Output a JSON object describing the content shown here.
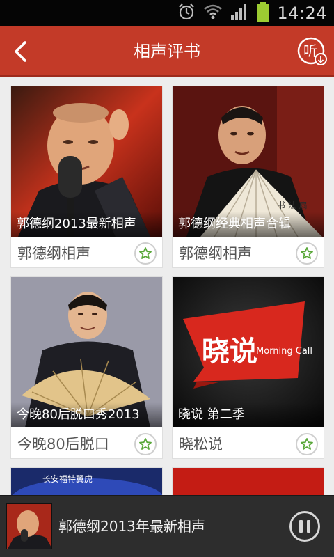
{
  "status_bar": {
    "time": "14:24",
    "icons": [
      "alarm-icon",
      "wifi-icon",
      "signal-icon",
      "battery-icon"
    ]
  },
  "header": {
    "title": "相声评书",
    "back_icon": "back-arrow-icon",
    "listen_icon": "listen-download-icon",
    "listen_label": "听",
    "background": "#c33a28"
  },
  "albums": [
    {
      "caption": "郭德纲2013最新相声",
      "artist": "郭德纲相声",
      "fav_icon": "star-icon"
    },
    {
      "caption": "郭德纲经典相声合辑",
      "artist": "郭德纲相声",
      "fav_icon": "star-icon"
    },
    {
      "caption": "今晚80后脱口秀2013",
      "artist": "今晚80后脱口",
      "fav_icon": "star-icon"
    },
    {
      "caption": "晓说 第二季",
      "artist": "晓松说",
      "fav_icon": "star-icon"
    },
    {
      "cover_text": "长安福特翼虎"
    }
  ],
  "logo": {
    "text_cn": "晓说",
    "text_en": "Morning Call"
  },
  "player": {
    "now_playing": "郭德纲2013年最新相声",
    "pause_icon": "pause-icon"
  },
  "colors": {
    "accent": "#c33a28",
    "star": "#5aa83a",
    "player_bg": "#2d2d2d"
  }
}
